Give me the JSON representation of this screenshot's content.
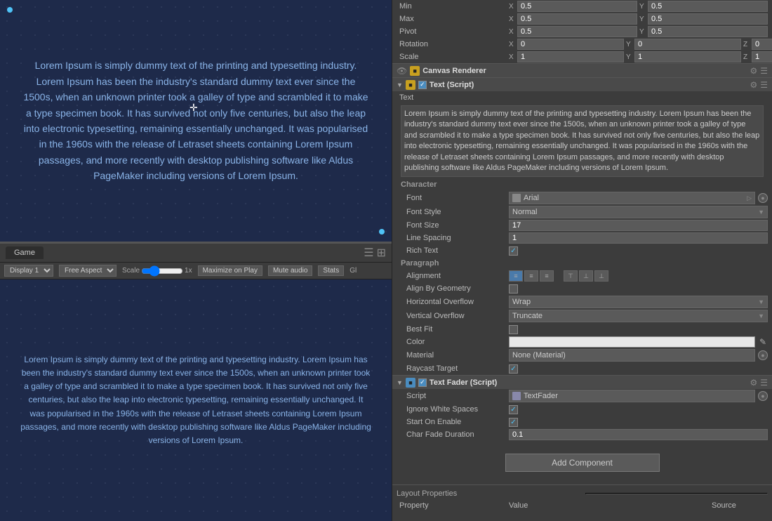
{
  "gamePanel": {
    "tab": "Game",
    "displayLabel": "Display 1",
    "aspectLabel": "Free Aspect",
    "scaleLabel": "Scale",
    "scaleValue": "1x",
    "maximizeLabel": "Maximize on Play",
    "muteLabel": "Mute audio",
    "statsLabel": "Stats",
    "glLabel": "Gl",
    "loremText": "Lorem Ipsum is simply dummy text of the printing and typesetting industry. Lorem Ipsum has been the industry's standard dummy text ever since the 1500s, when an unknown printer took a galley of type and scrambled it to make a type specimen book. It has survived not only five centuries, but also the leap into electronic typesetting, remaining essentially unchanged. It was popularised in the 1960s with the release of Letraset sheets containing Lorem Ipsum passages, and more recently with desktop publishing software like Aldus PageMaker including versions of Lorem Ipsum.",
    "loremTextBottom": "Lorem Ipsum is simply dummy text of the printing and typesetting industry. Lorem Ipsum has been the industry's standard dummy text ever since the 1500s, when an unknown printer took a galley of type and scrambled it to make a type specimen book. It has survived not only five centuries, but also the leap into electronic typesetting, remaining essentially unchanged. It was popularised in the 1960s with the release of Letraset sheets containing Lorem Ipsum passages, and more recently with desktop publishing software like Aldus PageMaker including versions of Lorem Ipsum."
  },
  "inspector": {
    "minLabel": "Min",
    "maxLabel": "Max",
    "pivotLabel": "Pivot",
    "rotationLabel": "Rotation",
    "scaleLabel": "Scale",
    "minX": "0.5",
    "minY": "0.5",
    "maxX": "0.5",
    "maxY": "0.5",
    "pivotX": "0.5",
    "pivotY": "0.5",
    "rotationX": "0",
    "rotationY": "0",
    "rotationZ": "0",
    "scaleX": "1",
    "scaleY": "1",
    "scaleZ": "1",
    "canvasRendererTitle": "Canvas Renderer",
    "textScriptTitle": "Text (Script)",
    "textLabel": "Text",
    "textContent": "Lorem Ipsum is simply dummy text of the printing and typesetting industry. Lorem Ipsum has been the industry's standard dummy text ever since the 1500s, when an unknown printer took a galley of type and scrambled it to make a type specimen book. It has survived not only five centuries, but also the leap into electronic typesetting, remaining essentially unchanged. It was popularised in the 1960s with the release of Letraset sheets containing Lorem Ipsum passages, and more recently with desktop publishing software like Aldus PageMaker including versions of Lorem Ipsum.",
    "characterLabel": "Character",
    "fontLabel": "Font",
    "fontValue": "Arial",
    "fontStyleLabel": "Font Style",
    "fontStyleValue": "Normal",
    "fontSizeLabel": "Font Size",
    "fontSizeValue": "17",
    "lineSpacingLabel": "Line Spacing",
    "lineSpacingValue": "1",
    "richTextLabel": "Rich Text",
    "richTextChecked": true,
    "paragraphLabel": "Paragraph",
    "alignmentLabel": "Alignment",
    "alignByGeometryLabel": "Align By Geometry",
    "horizontalOverflowLabel": "Horizontal Overflow",
    "horizontalOverflowValue": "Wrap",
    "verticalOverflowLabel": "Vertical Overflow",
    "verticalOverflowValue": "Truncate",
    "bestFitLabel": "Best Fit",
    "colorLabel": "Color",
    "materialLabel": "Material",
    "materialValue": "None (Material)",
    "raycastTargetLabel": "Raycast Target",
    "raycastTargetChecked": true,
    "textFaderTitle": "Text Fader (Script)",
    "scriptLabel": "Script",
    "scriptValue": "TextFader",
    "ignoreWhiteSpacesLabel": "Ignore White Spaces",
    "ignoreWhiteSpacesChecked": true,
    "startOnEnableLabel": "Start On Enable",
    "startOnEnableChecked": true,
    "charFadeDurationLabel": "Char Fade Duration",
    "charFadeDurationValue": "0.1",
    "addComponentLabel": "Add Component",
    "layoutPropertiesLabel": "Layout Properties",
    "propertyLabel": "Property",
    "valueLabel": "Value",
    "sourceLabel": "Source"
  }
}
